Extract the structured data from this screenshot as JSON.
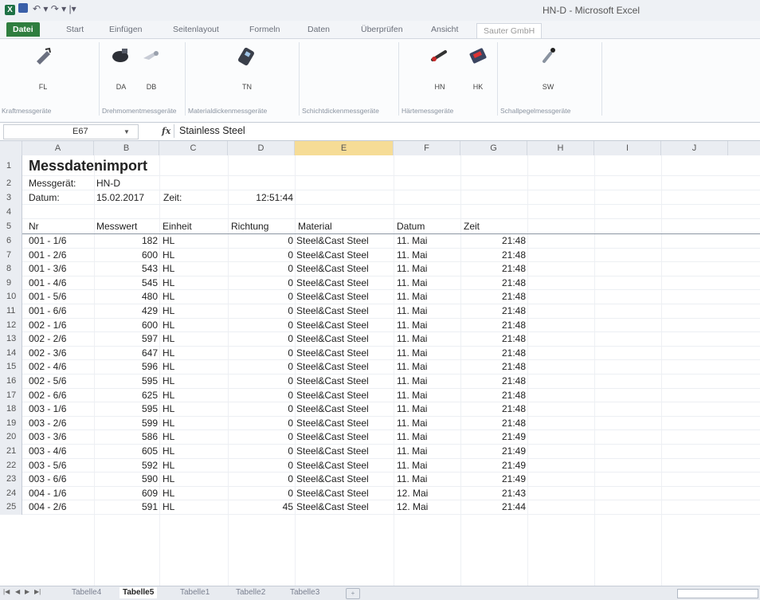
{
  "window": {
    "title": "HN-D  -  Microsoft Excel"
  },
  "tabs": [
    {
      "label": "Datei"
    },
    {
      "label": "Start"
    },
    {
      "label": "Einfügen"
    },
    {
      "label": "Seitenlayout"
    },
    {
      "label": "Formeln"
    },
    {
      "label": "Daten"
    },
    {
      "label": "Überprüfen"
    },
    {
      "label": "Ansicht"
    },
    {
      "label": "Sauter GmbH"
    }
  ],
  "ribbon": {
    "buttons": [
      {
        "label": "FL",
        "icon": "force-gauge-icon"
      },
      {
        "label": "DA",
        "icon": "torque-meter-icon"
      },
      {
        "label": "DB",
        "icon": "torque-meter-b-icon"
      },
      {
        "label": "TN",
        "icon": "thickness-meter-icon"
      },
      {
        "label": "HN",
        "icon": "hardness-probe-icon"
      },
      {
        "label": "HK",
        "icon": "hardness-tester-icon"
      },
      {
        "label": "SW",
        "icon": "sound-meter-icon"
      }
    ],
    "groups": [
      "Kraftmessgeräte",
      "Drehmomentmessgeräte",
      "Materialdickenmessgeräte",
      "Schichtdickenmessgeräte",
      "Härtemessgeräte",
      "Schallpegelmessgeräte"
    ]
  },
  "formula_bar": {
    "name_box": "E67",
    "fx": "fx",
    "value": "Stainless Steel"
  },
  "columns": [
    "A",
    "B",
    "C",
    "D",
    "E",
    "F",
    "G",
    "H",
    "I",
    "J"
  ],
  "sheet": {
    "title": "Messdatenimport",
    "device_label": "Messgerät:",
    "device_value": "HN-D",
    "date_label": "Datum:",
    "date_value": "15.02.2017",
    "time_label": "Zeit:",
    "time_value": "12:51:44",
    "headers": [
      "Nr",
      "Messwert",
      "Einheit",
      "Richtung",
      "Material",
      "Datum",
      "Zeit"
    ],
    "rows": [
      [
        "001 - 1/6",
        "182",
        "HL",
        "0",
        "Steel&Cast Steel",
        "11. Mai",
        "21:48"
      ],
      [
        "001 - 2/6",
        "600",
        "HL",
        "0",
        "Steel&Cast Steel",
        "11. Mai",
        "21:48"
      ],
      [
        "001 - 3/6",
        "543",
        "HL",
        "0",
        "Steel&Cast Steel",
        "11. Mai",
        "21:48"
      ],
      [
        "001 - 4/6",
        "545",
        "HL",
        "0",
        "Steel&Cast Steel",
        "11. Mai",
        "21:48"
      ],
      [
        "001 - 5/6",
        "480",
        "HL",
        "0",
        "Steel&Cast Steel",
        "11. Mai",
        "21:48"
      ],
      [
        "001 - 6/6",
        "429",
        "HL",
        "0",
        "Steel&Cast Steel",
        "11. Mai",
        "21:48"
      ],
      [
        "002 - 1/6",
        "600",
        "HL",
        "0",
        "Steel&Cast Steel",
        "11. Mai",
        "21:48"
      ],
      [
        "002 - 2/6",
        "597",
        "HL",
        "0",
        "Steel&Cast Steel",
        "11. Mai",
        "21:48"
      ],
      [
        "002 - 3/6",
        "647",
        "HL",
        "0",
        "Steel&Cast Steel",
        "11. Mai",
        "21:48"
      ],
      [
        "002 - 4/6",
        "596",
        "HL",
        "0",
        "Steel&Cast Steel",
        "11. Mai",
        "21:48"
      ],
      [
        "002 - 5/6",
        "595",
        "HL",
        "0",
        "Steel&Cast Steel",
        "11. Mai",
        "21:48"
      ],
      [
        "002 - 6/6",
        "625",
        "HL",
        "0",
        "Steel&Cast Steel",
        "11. Mai",
        "21:48"
      ],
      [
        "003 - 1/6",
        "595",
        "HL",
        "0",
        "Steel&Cast Steel",
        "11. Mai",
        "21:48"
      ],
      [
        "003 - 2/6",
        "599",
        "HL",
        "0",
        "Steel&Cast Steel",
        "11. Mai",
        "21:48"
      ],
      [
        "003 - 3/6",
        "586",
        "HL",
        "0",
        "Steel&Cast Steel",
        "11. Mai",
        "21:49"
      ],
      [
        "003 - 4/6",
        "605",
        "HL",
        "0",
        "Steel&Cast Steel",
        "11. Mai",
        "21:49"
      ],
      [
        "003 - 5/6",
        "592",
        "HL",
        "0",
        "Steel&Cast Steel",
        "11. Mai",
        "21:49"
      ],
      [
        "003 - 6/6",
        "590",
        "HL",
        "0",
        "Steel&Cast Steel",
        "11. Mai",
        "21:49"
      ],
      [
        "004 - 1/6",
        "609",
        "HL",
        "0",
        "Steel&Cast Steel",
        "12. Mai",
        "21:43"
      ],
      [
        "004 - 2/6",
        "591",
        "HL",
        "45",
        "Steel&Cast Steel",
        "12. Mai",
        "21:44"
      ]
    ]
  },
  "sheet_tabs": [
    "Tabelle4",
    "Tabelle5",
    "Tabelle1",
    "Tabelle2",
    "Tabelle3"
  ],
  "active_sheet": "Tabelle5"
}
